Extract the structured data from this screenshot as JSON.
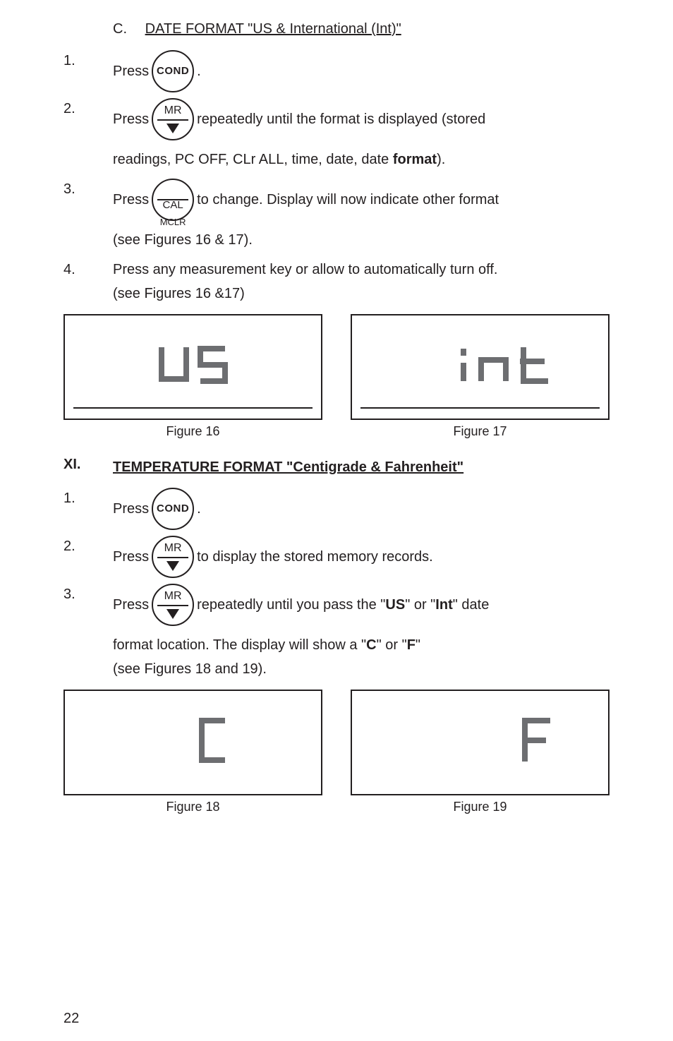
{
  "sectionC": {
    "letter": "C.",
    "title": "DATE FORMAT \"US & International (Int)\""
  },
  "steps1": {
    "s1": {
      "num": "1.",
      "pre": "Press",
      "btn": "COND",
      "post": " ."
    },
    "s2": {
      "num": "2.",
      "pre": "Press",
      "btn_top": "MR",
      "mid": "repeatedly until the format is displayed (stored",
      "line2": "readings, PC OFF, CLr ALL, time, date, date ",
      "bold": "format",
      "tail": ")."
    },
    "s3": {
      "num": "3.",
      "pre": "Press",
      "btn_top": "CAL",
      "btn_bot": "MCLR",
      "mid": "to change. Display will now indicate other format",
      "line2": "(see Figures 16 & 17)."
    },
    "s4": {
      "num": "4.",
      "line1": "Press any measurement key or allow to automatically turn off.",
      "line2": "(see Figures 16 &17)"
    }
  },
  "figs1": {
    "left": {
      "caption": "Figure 16"
    },
    "right": {
      "caption": "Figure 17"
    }
  },
  "sectionXI": {
    "roman": "XI.",
    "title": "TEMPERATURE FORMAT \"Centigrade & Fahrenheit\""
  },
  "steps2": {
    "s1": {
      "num": "1.",
      "pre": "Press",
      "btn": "COND",
      "post": "."
    },
    "s2": {
      "num": "2.",
      "pre": "Press",
      "btn_top": "MR",
      "post": " to display the stored memory records."
    },
    "s3": {
      "num": "3.",
      "pre": "Press",
      "btn_top": "MR",
      "mid": "repeatedly until you pass the \"",
      "bold1": "US",
      "mid2": "\" or \"",
      "bold2": "Int",
      "mid3": "\" date",
      "line2a": "format location. The display will show a \"",
      "boldC": "C",
      "line2b": "\" or \"",
      "boldF": "F",
      "line2c": "\"",
      "line3": "(see Figures 18 and 19)."
    }
  },
  "figs2": {
    "left": {
      "caption": "Figure 18"
    },
    "right": {
      "caption": "Figure 19"
    }
  },
  "pageNumber": "22"
}
